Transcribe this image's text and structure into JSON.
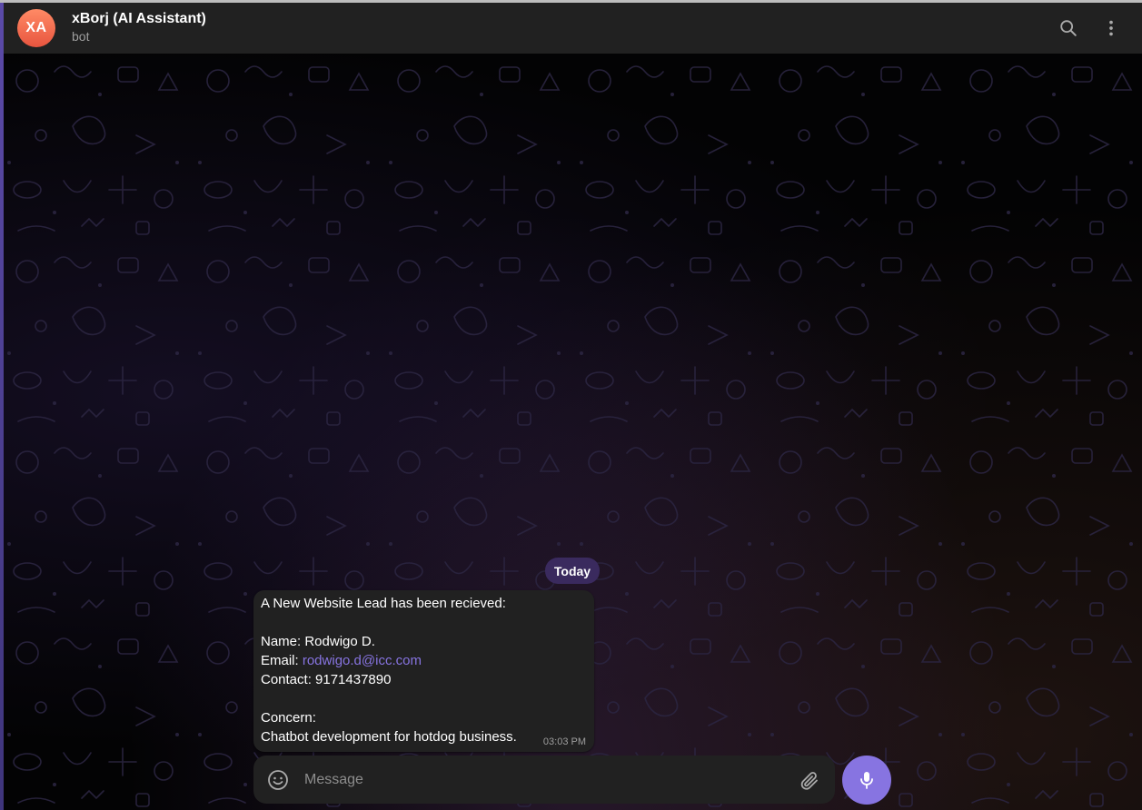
{
  "header": {
    "avatar_initials": "XA",
    "title": "xBorj (AI Assistant)",
    "subtitle": "bot",
    "search_icon": "search-icon",
    "more_icon": "more-vertical-icon"
  },
  "chat": {
    "date_separator": "Today",
    "message": {
      "line1": "A New Website Lead has been recieved:",
      "name_line": "Name: Rodwigo D.",
      "email_label": "Email: ",
      "email_value": "rodwigo.d@icc.com",
      "contact_line": "Contact: 9171437890",
      "concern_label": "Concern:",
      "concern_text": "Chatbot development for hotdog business.",
      "time": "03:03 PM"
    }
  },
  "composer": {
    "placeholder": "Message",
    "emoji_icon": "smile-icon",
    "attach_icon": "paperclip-icon",
    "mic_icon": "microphone-icon"
  },
  "colors": {
    "accent": "#8774e1",
    "header_bg": "#212121",
    "bubble_bg": "#212121",
    "date_pill_bg": "#3a2a5e",
    "avatar_bg": "#e8553f"
  }
}
